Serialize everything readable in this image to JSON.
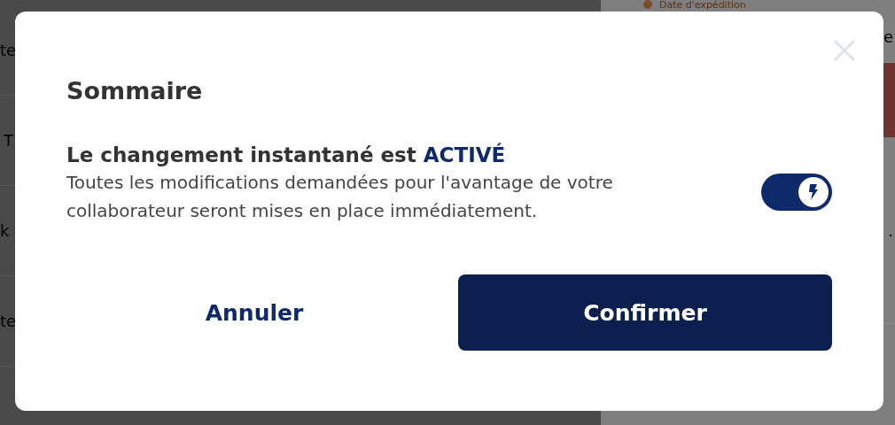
{
  "background": {
    "top_label": "Date d'expédition",
    "left_cells": [
      "te",
      "T",
      "k",
      "te"
    ],
    "right_cells": [
      "e",
      "."
    ]
  },
  "dialog": {
    "title": "Sommaire",
    "heading": "Le changement instantané est",
    "status": "ACTIVÉ",
    "description": "Toutes les modifications demandées pour l'avantage de votre collaborateur seront mises en place immédiatement.",
    "instant_change": {
      "on": true
    },
    "buttons": [
      {
        "label": "Annuler",
        "kind": "link"
      },
      {
        "label": "Confirmer",
        "kind": "primary"
      }
    ]
  }
}
